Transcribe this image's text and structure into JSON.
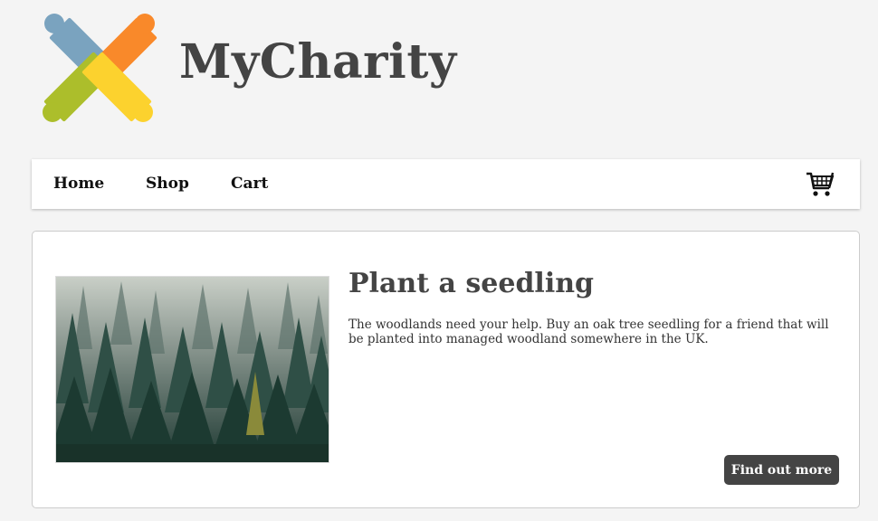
{
  "brand": {
    "title": "MyCharity",
    "logo": "puzzle-logo-icon"
  },
  "nav": {
    "items": [
      {
        "label": "Home"
      },
      {
        "label": "Shop"
      },
      {
        "label": "Cart"
      }
    ],
    "cart_icon": "shopping-cart-icon"
  },
  "feature": {
    "title": "Plant a seedling",
    "description": "The woodlands need your help. Buy an oak tree seedling for a friend that will be planted into managed woodland somewhere in the UK.",
    "button_label": "Find out more",
    "image": "forest-image"
  },
  "colors": {
    "background": "#f4f4f4",
    "text_dark": "#444444",
    "button_bg": "#444444",
    "logo_blue": "#7aa3bf",
    "logo_orange": "#f9892a",
    "logo_green": "#acbe2b",
    "logo_yellow": "#fcd22e"
  }
}
